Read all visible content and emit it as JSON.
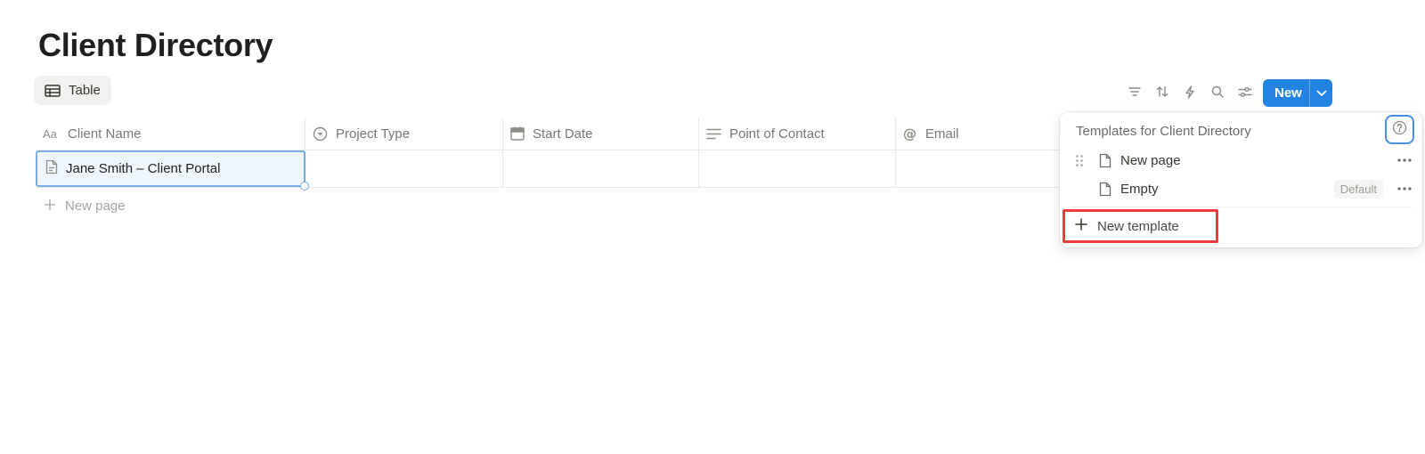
{
  "page": {
    "title": "Client Directory"
  },
  "view_tab": {
    "label": "Table",
    "icon": "table-icon"
  },
  "toolbar": {
    "tools": [
      "filter-icon",
      "sort-icon",
      "automation-icon",
      "search-icon",
      "settings-icon"
    ],
    "new_button_label": "New"
  },
  "table": {
    "columns": [
      {
        "label": "Client Name",
        "icon": "text-type-icon"
      },
      {
        "label": "Project Type",
        "icon": "select-icon"
      },
      {
        "label": "Start Date",
        "icon": "calendar-icon"
      },
      {
        "label": "Point of Contact",
        "icon": "text-lines-icon"
      },
      {
        "label": "Email",
        "icon": "at-icon"
      }
    ],
    "rows": [
      {
        "client_name": "Jane Smith – Client Portal"
      }
    ],
    "new_page_label": "New page"
  },
  "templates_popup": {
    "title": "Templates for Client Directory",
    "items": [
      {
        "label": "New page",
        "badge": ""
      },
      {
        "label": "Empty",
        "badge": "Default"
      }
    ],
    "new_template_label": "New template"
  },
  "colors": {
    "accent": "#2383e2",
    "selection": "#78aee3",
    "highlight_box": "#ee3b3b"
  }
}
